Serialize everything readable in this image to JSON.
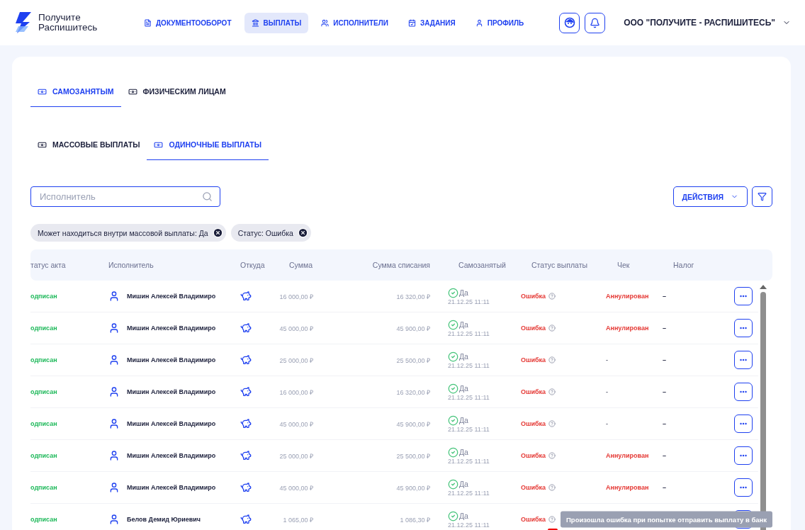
{
  "logo": {
    "line1": "Получите",
    "line2": "Распишитесь"
  },
  "nav": [
    {
      "label": "ДОКУМЕНТООБОРОТ",
      "selected": false
    },
    {
      "label": "ВЫПЛАТЫ",
      "selected": true
    },
    {
      "label": "ИСПОЛНИТЕЛИ",
      "selected": false
    },
    {
      "label": "ЗАДАНИЯ",
      "selected": false
    },
    {
      "label": "ПРОФИЛЬ",
      "selected": false
    }
  ],
  "company": "ООО \"ПОЛУЧИТЕ - РАСПИШИТЕСЬ\"",
  "tabs": [
    {
      "label": "САМОЗАНЯТЫМ",
      "selected": true
    },
    {
      "label": "ФИЗИЧЕСКИМ ЛИЦАМ",
      "selected": false
    }
  ],
  "subtabs": [
    {
      "label": "МАССОВЫЕ ВЫПЛАТЫ",
      "selected": false
    },
    {
      "label": "ОДИНОЧНЫЕ ВЫПЛАТЫ",
      "selected": true
    }
  ],
  "search": {
    "placeholder": "Исполнитель"
  },
  "actions_button": "ДЕЙСТВИЯ",
  "filters": [
    {
      "label": "Может находиться внутри массовой выплаты: Да"
    },
    {
      "label": "Статус: Ошибка"
    }
  ],
  "table": {
    "columns": [
      "татус акта",
      "Исполнитель",
      "Откуда",
      "Сумма",
      "Сумма списания",
      "Самозанятый",
      "Статус выплаты",
      "Чек",
      "Налог"
    ],
    "rows": [
      {
        "act_status": "одписан",
        "performer": "Мишин Алексей Владимиро",
        "amount": "16 000,00 ₽",
        "debit": "16 320,00 ₽",
        "self_employed": "Да",
        "date": "21.12.25 11:11",
        "payout_status": "Ошибка",
        "check": "Аннулирован",
        "check_cancelled": true,
        "tax": "–"
      },
      {
        "act_status": "одписан",
        "performer": "Мишин Алексей Владимиро",
        "amount": "45 000,00 ₽",
        "debit": "45 900,00 ₽",
        "self_employed": "Да",
        "date": "21.12.25 11:11",
        "payout_status": "Ошибка",
        "check": "Аннулирован",
        "check_cancelled": true,
        "tax": "–"
      },
      {
        "act_status": "одписан",
        "performer": "Мишин Алексей Владимиро",
        "amount": "25 000,00 ₽",
        "debit": "25 500,00 ₽",
        "self_employed": "Да",
        "date": "21.12.25 11:11",
        "payout_status": "Ошибка",
        "check": "-",
        "check_cancelled": false,
        "tax": "–"
      },
      {
        "act_status": "одписан",
        "performer": "Мишин Алексей Владимиро",
        "amount": "16 000,00 ₽",
        "debit": "16 320,00 ₽",
        "self_employed": "Да",
        "date": "21.12.25 11:11",
        "payout_status": "Ошибка",
        "check": "-",
        "check_cancelled": false,
        "tax": "–"
      },
      {
        "act_status": "одписан",
        "performer": "Мишин Алексей Владимиро",
        "amount": "45 000,00 ₽",
        "debit": "45 900,00 ₽",
        "self_employed": "Да",
        "date": "21.12.25 11:11",
        "payout_status": "Ошибка",
        "check": "-",
        "check_cancelled": false,
        "tax": "–"
      },
      {
        "act_status": "одписан",
        "performer": "Мишин Алексей Владимиро",
        "amount": "25 000,00 ₽",
        "debit": "25 500,00 ₽",
        "self_employed": "Да",
        "date": "21.12.25 11:11",
        "payout_status": "Ошибка",
        "check": "Аннулирован",
        "check_cancelled": true,
        "tax": "–"
      },
      {
        "act_status": "одписан",
        "performer": "Мишин Алексей Владимиро",
        "amount": "45 000,00 ₽",
        "debit": "45 900,00 ₽",
        "self_employed": "Да",
        "date": "21.12.25 11:11",
        "payout_status": "Ошибка",
        "check": "Аннулирован",
        "check_cancelled": true,
        "tax": "–"
      },
      {
        "act_status": "одписан",
        "performer": "Белов Демид Юриевич",
        "amount": "1 065,00 ₽",
        "debit": "1 086,30 ₽",
        "self_employed": "Да",
        "date": "21.12.25 11:11",
        "payout_status": "Ошибка",
        "tooltip": "Произошла ошибка при попытке отправить выплату в банк"
      }
    ]
  }
}
